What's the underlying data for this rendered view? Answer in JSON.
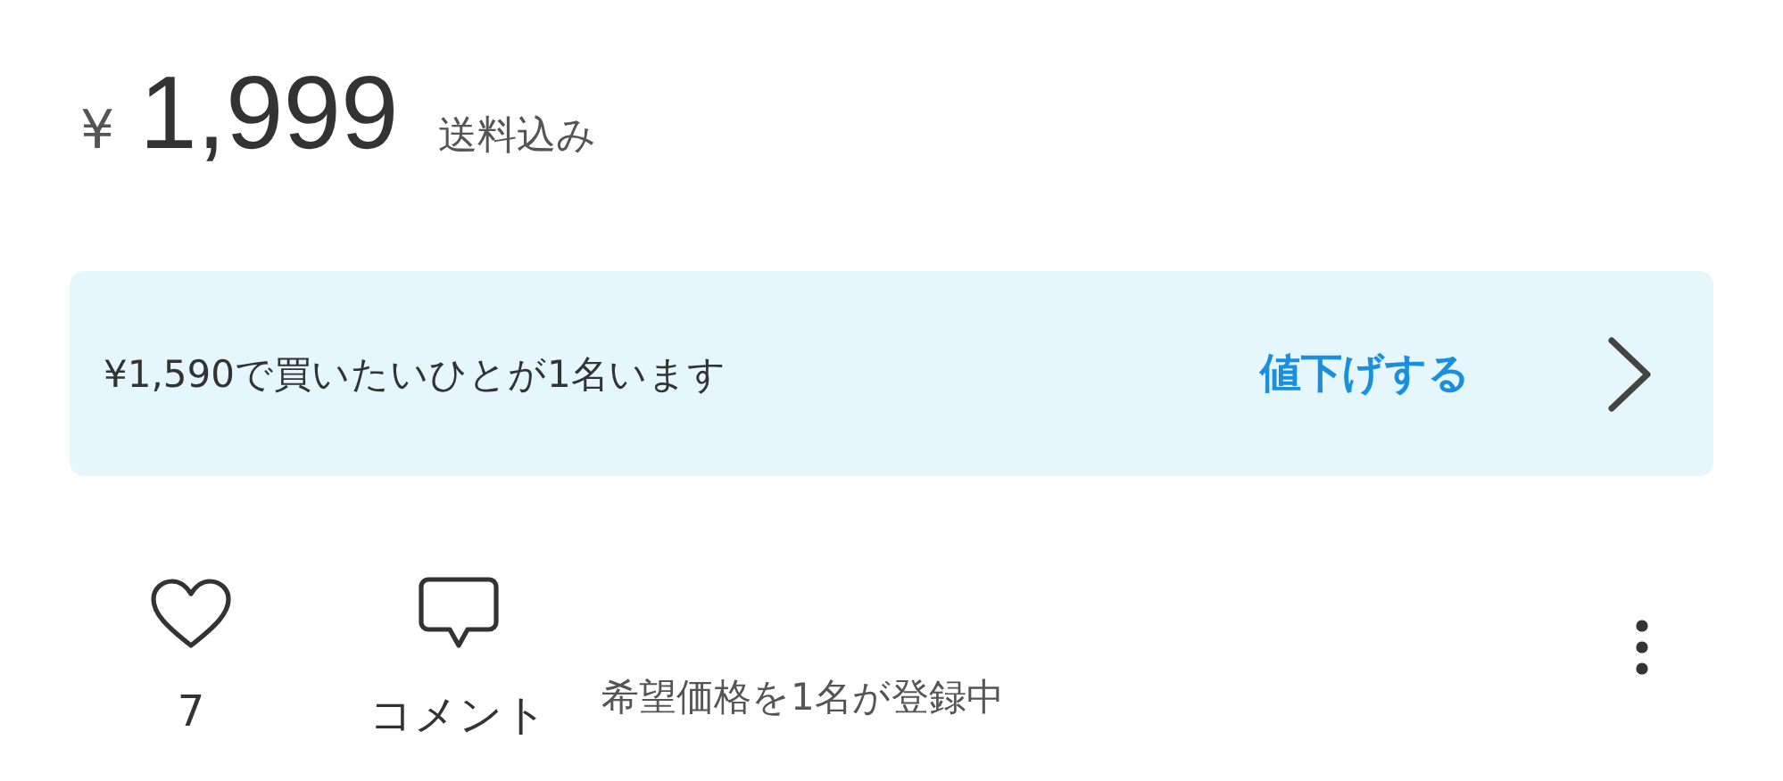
{
  "price": {
    "currency": "¥",
    "amount": "1,999",
    "shipping": "送料込み"
  },
  "offer_banner": {
    "message": "¥1,590で買いたいひとが1名います",
    "action": "値下げする"
  },
  "actions": {
    "like_count": "7",
    "comment_label": "コメント",
    "offer_status": "希望価格を1名が登録中"
  }
}
